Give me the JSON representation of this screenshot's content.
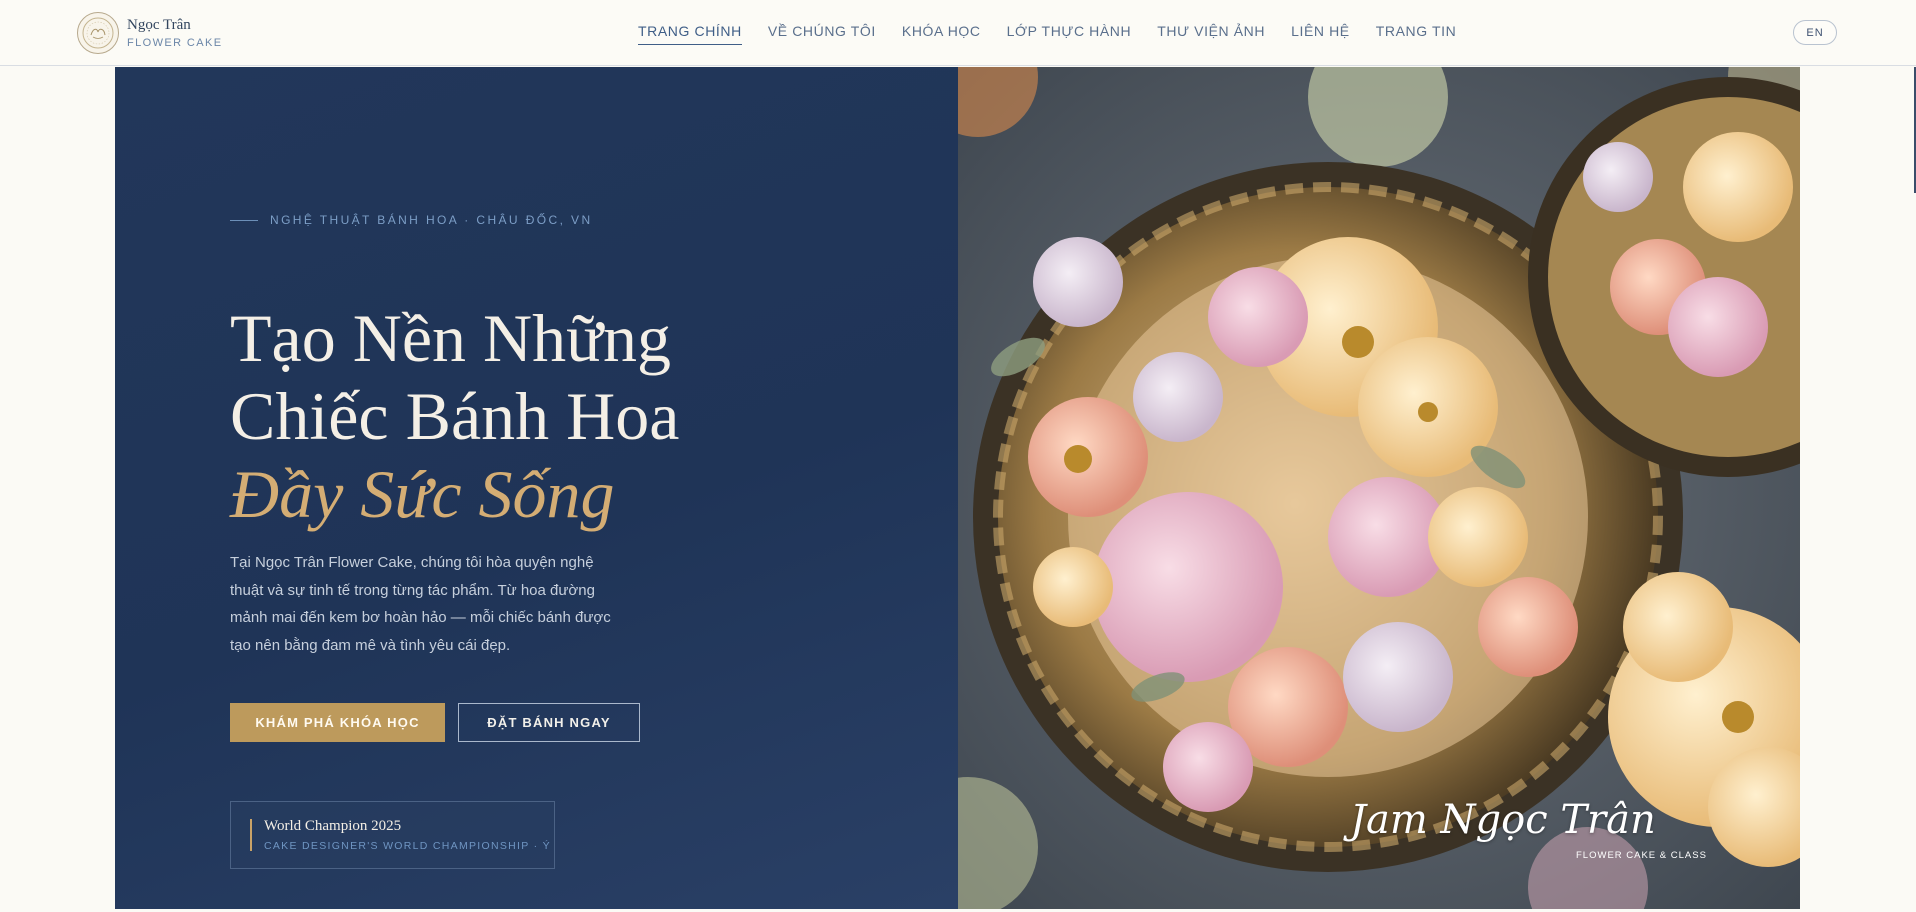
{
  "brand": {
    "name": "Ngọc Trân",
    "subtitle": "FLOWER CAKE"
  },
  "nav": {
    "items": [
      {
        "label": "TRANG CHÍNH",
        "active": true
      },
      {
        "label": "VỀ CHÚNG TÔI",
        "active": false
      },
      {
        "label": "KHÓA HỌC",
        "active": false
      },
      {
        "label": "LỚP THỰC HÀNH",
        "active": false
      },
      {
        "label": "THƯ VIỆN ẢNH",
        "active": false
      },
      {
        "label": "LIÊN HỆ",
        "active": false
      },
      {
        "label": "TRANG TIN",
        "active": false
      }
    ],
    "language": "EN"
  },
  "hero": {
    "eyebrow": "NGHỆ THUẬT BÁNH HOA · CHÂU ĐỐC, VN",
    "title_line1": "Tạo Nền Những",
    "title_line2": "Chiếc Bánh Hoa",
    "title_accent": "Đầy Sức Sống",
    "description": "Tại Ngọc Trân Flower Cake, chúng tôi hòa quyện nghệ thuật và sự tinh tế trong từng tác phẩm. Từ hoa đường mảnh mai đến kem bơ hoàn hảo — mỗi chiếc bánh được tạo nên bằng đam mê và tình yêu cái đẹp.",
    "primary_button": "KHÁM PHÁ KHÓA HỌC",
    "secondary_button": "ĐẶT BÁNH NGAY",
    "award_title": "World Champion 2025",
    "award_subtitle": "CAKE DESIGNER'S WORLD CHAMPIONSHIP · Ý"
  },
  "photo": {
    "signature": "Jam Ngọc Trân",
    "signature_subtitle": "FLOWER CAKE & CLASS"
  },
  "colors": {
    "navy": "#22375a",
    "gold": "#bd9a5c",
    "cream": "#fbfaf5",
    "accent_text": "#d4ad74"
  }
}
